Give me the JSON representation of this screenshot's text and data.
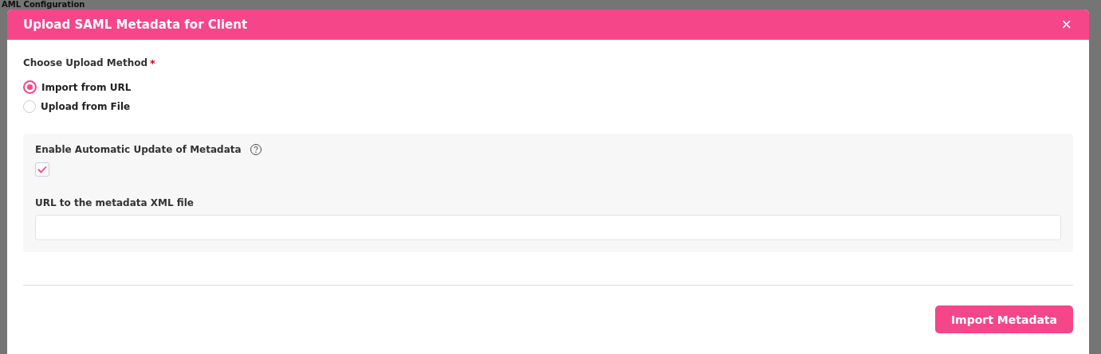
{
  "background": {
    "heading": "AML Configuration"
  },
  "dialog": {
    "title": "Upload SAML Metadata for Client",
    "close": "×"
  },
  "upload_method": {
    "label": "Choose Upload Method",
    "required_mark": "*",
    "options": [
      {
        "label": "Import from URL",
        "selected": true
      },
      {
        "label": "Upload from File",
        "selected": false
      }
    ]
  },
  "auto_update": {
    "label": "Enable Automatic Update of Metadata",
    "checked": true
  },
  "url_field": {
    "label": "URL to the metadata XML file"
  },
  "buttons": [
    {
      "label": "Import Metadata"
    }
  ]
}
